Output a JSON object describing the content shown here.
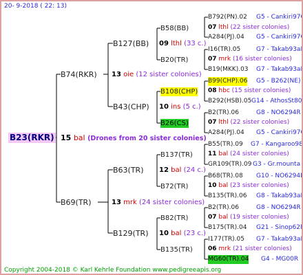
{
  "header": "20-  9-2018 (  22:  13)",
  "root": {
    "label": "B23(RKR)",
    "gen_num": "15",
    "gen_vial": "bal",
    "gen_note": "(Drones from 20 sister colonies)"
  },
  "level1": [
    {
      "label": "B74(RKR)",
      "num": "13",
      "vial": "oie",
      "note": "(12 sister colonies)"
    },
    {
      "label": "B69(TR)",
      "num": "13",
      "vial": "mrk",
      "note": "(24 sister colonies)"
    }
  ],
  "level2": [
    {
      "label": "B127(BB)",
      "num": "09",
      "vial": "lthl",
      "note": "(33 c.)"
    },
    {
      "label": "B43(CHP)",
      "num": "10",
      "vial": "ins",
      "note": "(5 c.)"
    },
    {
      "label": "B63(TR)",
      "num": "12",
      "vial": "bal",
      "note": "(24 c.)"
    },
    {
      "label": "B129(TR)",
      "num": "10",
      "vial": "bal",
      "note": "(23 c.)"
    }
  ],
  "level3": [
    {
      "label": "B58(BB)",
      "num": "07",
      "vial": "lthl",
      "note": "(22 sister colonies)"
    },
    {
      "label": "B20(TR)",
      "num": "07",
      "vial": "mrk",
      "note": "(16 sister colonies)"
    },
    {
      "label": "B108(CHP)",
      "num": "08",
      "vial": "hbc",
      "note": "(15 sister colonies)"
    },
    {
      "label": "B26(CS)",
      "num": "07",
      "vial": "lthl",
      "note": "(22 sister colonies)"
    },
    {
      "label": "B137(TR)",
      "num": "11",
      "vial": "bal",
      "note": "(24 sister colonies)"
    },
    {
      "label": "B72(TR)",
      "num": "10",
      "vial": "bal",
      "note": "(23 sister colonies)"
    },
    {
      "label": "B82(TR)",
      "num": "07",
      "vial": "bal",
      "note": "(19 sister colonies)"
    },
    {
      "label": "B135(TR)",
      "num": "06",
      "vial": "mrk",
      "note": "(21 sister colonies)"
    }
  ],
  "level4": [
    {
      "label": "B792(PN).02",
      "info": "G5 - Cankiri97Q"
    },
    {
      "label": "A284(PJ).04",
      "info": "G5 - Cankiri97Q"
    },
    {
      "label": "I16(TR).05",
      "info": "G7 - Takab93aR"
    },
    {
      "label": "B19(MKK).03",
      "info": "G7 - Takab93aR"
    },
    {
      "label": "B99(CHP).06",
      "info": "G5 - B262(NE)"
    },
    {
      "label": "B292(HSB).05",
      "info": "G14 - AthosSt80R"
    },
    {
      "label": "B2(TR).06",
      "info": "G8 - NO6294R"
    },
    {
      "label": "A284(PJ).04",
      "info": "G5 - Cankiri97Q"
    },
    {
      "label": "B55(TR).09",
      "info": "G7 - Kangaroo98R"
    },
    {
      "label": "GR109(TR).09",
      "info": "G3 - Gr.mounta"
    },
    {
      "label": "B68(TR).08",
      "info": "G10 - NO6294R"
    },
    {
      "label": "B135(TR).06",
      "info": "G8 - Takab93aR"
    },
    {
      "label": "B2(TR).06",
      "info": "G8 - NO6294R"
    },
    {
      "label": "B175(TR).04",
      "info": "G21 - Sinop62R"
    },
    {
      "label": "I177(TR).05",
      "info": "G7 - Takab93aR"
    },
    {
      "label": "MG60(TR).04",
      "info": "G4 - MG00R"
    }
  ],
  "footer": "Copyright 2004-2018 © Karl Kehrle Foundation    www.pedigreeapis.org"
}
